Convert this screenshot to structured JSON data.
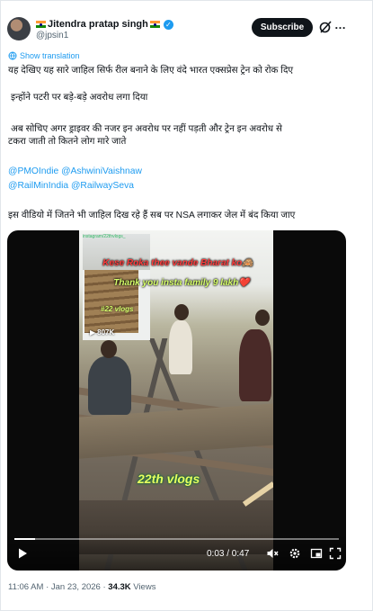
{
  "author": {
    "display_name": "Jitendra pratap singh",
    "handle": "@jpsin1"
  },
  "actions": {
    "subscribe_label": "Subscribe",
    "more_label": "…"
  },
  "translate": {
    "label": "Show translation"
  },
  "body": {
    "line1": "यह देखिए यह सारे जाहिल सिर्फ रील बनाने के लिए वंदे भारत एक्सप्रेस ट्रेन को रोक दिए",
    "line2": "इन्होंने पटरी पर बड़े-बड़े अवरोध लगा दिया",
    "line3a": "अब सोचिए अगर ड्राइवर की नजर इन अवरोध पर नहीं पड़ती और ट्रेन इन अवरोध से",
    "line3b": "टकरा जाती तो कितने लोग मारे जाते",
    "mentions1": "@PMOIndie @AshwiniVaishnaw",
    "mentions2": "@RailMinIndia @RailwaySeva",
    "line4": "इस वीडियो में जितने भी जाहिल दिख रहे हैं सब पर NSA  लगाकर जेल में बंद किया जाए"
  },
  "video": {
    "watermark": "instagram/22thvlogs_",
    "caption_top": "Kese Roka thee vande Bharat ko🙈",
    "caption_second": "Thank you insta family  9 lakh❤️",
    "caption_third": "#22 vlogs",
    "view_count": "807K",
    "caption_bottom": "22th vlogs",
    "time_display": "0:03 / 0:47",
    "progress": 0.064
  },
  "meta": {
    "time": "11:06 AM",
    "date": "Jan 23, 2026",
    "views_count": "34.3K",
    "views_label": "Views",
    "sep": "·"
  },
  "colors": {
    "accent": "#1d9bf0",
    "text": "#0f1419",
    "muted": "#536471"
  }
}
